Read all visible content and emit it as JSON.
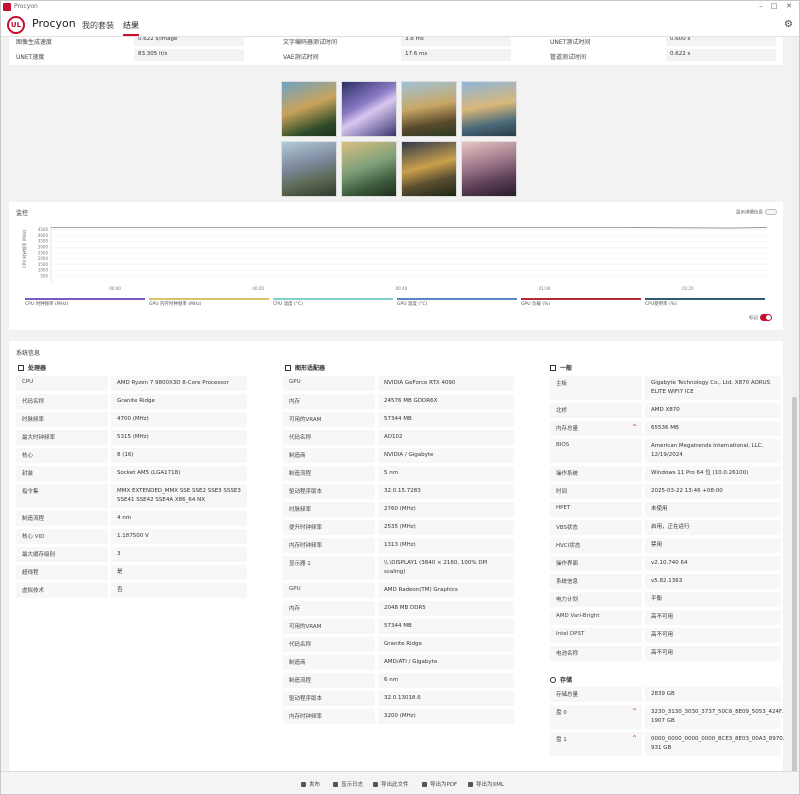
{
  "window": {
    "title": "Procyon"
  },
  "header": {
    "brand": "Procyon",
    "logo_text": "UL",
    "tabs": [
      "我的套装",
      "结果"
    ],
    "active_tab": "结果"
  },
  "metrics": {
    "rows": [
      [
        {
          "label": "图像生成速度",
          "value": "0.622 s/image"
        },
        {
          "label": "文字编码器测试时间",
          "value": "3.8 ms"
        },
        {
          "label": "UNET测试时间",
          "value": "0.600 s"
        }
      ],
      [
        {
          "label": "UNET速度",
          "value": "83.305 it/s"
        },
        {
          "label": "VAE测试时间",
          "value": "17.6 ms"
        },
        {
          "label": "管道测试时间",
          "value": "0.622 s"
        }
      ]
    ]
  },
  "monitor": {
    "title": "监控",
    "detail_toggle": "显示详细信息",
    "mark_toggle": "标记",
    "legend": [
      {
        "name": "CPU 时钟频率 (MHz)",
        "color": "#7a5cc0"
      },
      {
        "name": "GPU 内存时钟频率 (MHz)",
        "color": "#d8c36a"
      },
      {
        "name": "CPU 温度 (°C)",
        "color": "#7fd1c8"
      },
      {
        "name": "GPU 温度 (°C)",
        "color": "#5a87c6"
      },
      {
        "name": "GPU 负载 (%)",
        "color": "#b32a3a"
      },
      {
        "name": "CPU使用率 (%)",
        "color": "#2f5b73"
      }
    ]
  },
  "chart_data": {
    "type": "line",
    "ylabel": "CPU 时钟频率 (MHz)",
    "yticks": [
      500,
      1000,
      1500,
      2000,
      2500,
      3000,
      3500,
      4000,
      4500
    ],
    "xticks": [
      "00:00",
      "00:20",
      "00:40",
      "01:00",
      "01:20",
      "01:40"
    ],
    "ylim": [
      0,
      5000
    ],
    "series": [
      {
        "name": "CPU 时钟频率 (MHz)",
        "x": [
          0,
          20,
          40,
          60,
          80,
          95,
          100
        ],
        "values": [
          4700,
          4700,
          4700,
          4700,
          4700,
          4650,
          4700
        ]
      }
    ]
  },
  "sysinfo": {
    "title": "系统信息",
    "cpu": {
      "heading": "处理器",
      "rows": [
        {
          "label": "CPU",
          "value": "AMD Ryzen 7 9800X3D 8-Core Processor"
        },
        {
          "label": "代码名称",
          "value": "Granite Ridge"
        },
        {
          "label": "时脉频率",
          "value": "4700 (MHz)"
        },
        {
          "label": "最大时钟频率",
          "value": "5315 (MHz)"
        },
        {
          "label": "核心",
          "value": "8 (16)"
        },
        {
          "label": "封装",
          "value": "Socket AM5 (LGA1718)"
        },
        {
          "label": "指令集",
          "value": "MMX EXTENDED_MMX SSE SSE2 SSE3 SSSE3 SSE41 SSE42 SSE4A X86_64 NX"
        },
        {
          "label": "制造流程",
          "value": "4 nm"
        },
        {
          "label": "核心 VID",
          "value": "1.187500 V"
        },
        {
          "label": "最大缓存级别",
          "value": "3"
        },
        {
          "label": "超线程",
          "value": "是"
        },
        {
          "label": "虚拟技术",
          "value": "否"
        }
      ]
    },
    "gpu": {
      "heading": "图形适配器",
      "rows": [
        {
          "label": "GPU",
          "value": "NVIDIA GeForce RTX 4090"
        },
        {
          "label": "内存",
          "value": "24576 MB GDDR6X"
        },
        {
          "label": "可用的VRAM",
          "value": "57344 MB"
        },
        {
          "label": "代码名称",
          "value": "AD102"
        },
        {
          "label": "制造商",
          "value": "NVIDIA / Gigabyte"
        },
        {
          "label": "制造流程",
          "value": "5 nm"
        },
        {
          "label": "驱动程序版本",
          "value": "32.0.15.7283"
        },
        {
          "label": "时脉频率",
          "value": "2760 (MHz)"
        },
        {
          "label": "提升时钟频率",
          "value": "2535 (MHz)"
        },
        {
          "label": "内存时钟频率",
          "value": "1313 (MHz)"
        },
        {
          "label": "显示器 1",
          "value": "\\\\.\\DISPLAY1 (3840 × 2160, 100% DPI scaling)"
        },
        {
          "label": "GPU",
          "value": "AMD Radeon(TM) Graphics"
        },
        {
          "label": "内存",
          "value": "2048 MB DDR5"
        },
        {
          "label": "可用的VRAM",
          "value": "57344 MB"
        },
        {
          "label": "代码名称",
          "value": "Granite Ridge"
        },
        {
          "label": "制造商",
          "value": "AMD/ATI / Gigabyte"
        },
        {
          "label": "制造流程",
          "value": "6 nm"
        },
        {
          "label": "驱动程序版本",
          "value": "32.0.13018.6"
        },
        {
          "label": "内存时钟频率",
          "value": "3200 (MHz)"
        }
      ]
    },
    "general": {
      "heading": "一般",
      "rows": [
        {
          "label": "主板",
          "value": "Gigabyte Technology Co., Ltd. X870 AORUS ELITE WIFI7 ICE"
        },
        {
          "label": "北桥",
          "value": "AMD X870"
        },
        {
          "label": "内存总量",
          "value": "65536 MB"
        },
        {
          "label": "BIOS",
          "value": "American Megatrends International, LLC. 12/19/2024"
        },
        {
          "label": "操作系统",
          "value": "Windows 11 Pro 64 位 (10.0.26100)"
        },
        {
          "label": "时间",
          "value": "2025-03-22 13:46 +08:00"
        },
        {
          "label": "HPET",
          "value": "未使用"
        },
        {
          "label": "VBS状态",
          "value": "启用，正在运行"
        },
        {
          "label": "HVCI状态",
          "value": "禁用"
        },
        {
          "label": "操作界面",
          "value": "v2.10.740 64"
        },
        {
          "label": "系统信息",
          "value": "v5.82.1363"
        },
        {
          "label": "电力计划",
          "value": "平衡"
        },
        {
          "label": "AMD Vari-Bright",
          "value": "高不可用"
        },
        {
          "label": "Intel DPST",
          "value": "高不可用"
        },
        {
          "label": "电池名称",
          "value": "高不可用"
        }
      ]
    },
    "storage": {
      "heading": "存储",
      "rows": [
        {
          "label": "存储总量",
          "value": "2839 GB"
        },
        {
          "label": "盘 0",
          "value": "3230_3130_3030_3737_50C6_8E09_5053_424F. 1907 GB"
        },
        {
          "label": "盘 1",
          "value": "0000_0000_0000_0000_8CE3_8E03_00A3_8970. 931 GB"
        }
      ]
    }
  },
  "footer": {
    "buttons": [
      "发布",
      "显示日志",
      "导出此文件",
      "导出为PDF",
      "导出为XML"
    ]
  }
}
